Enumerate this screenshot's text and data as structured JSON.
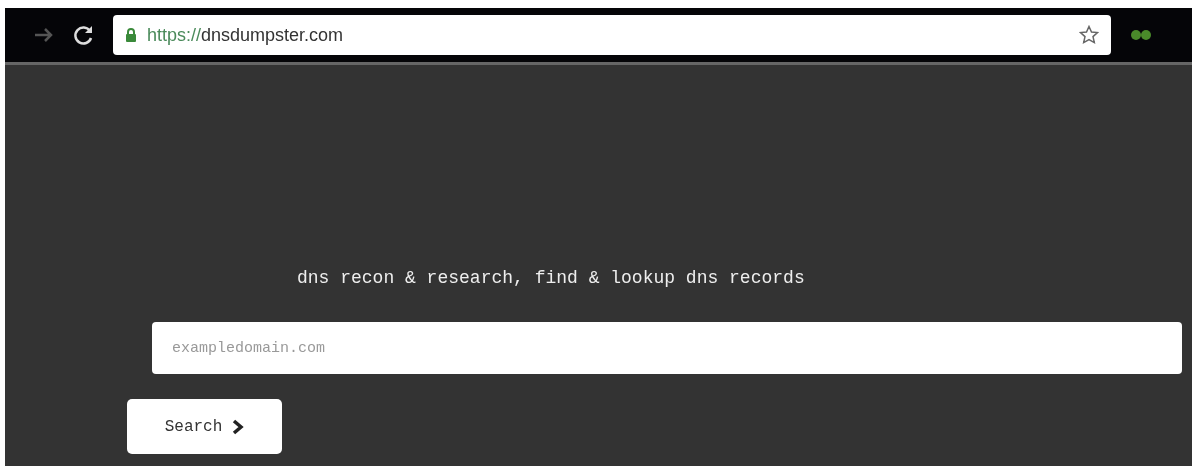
{
  "browser": {
    "url_scheme": "https://",
    "url_host": "dnsdumpster.com"
  },
  "page": {
    "tagline": "dns recon & research, find & lookup dns records",
    "search": {
      "placeholder": "exampledomain.com"
    },
    "button": "Search"
  }
}
